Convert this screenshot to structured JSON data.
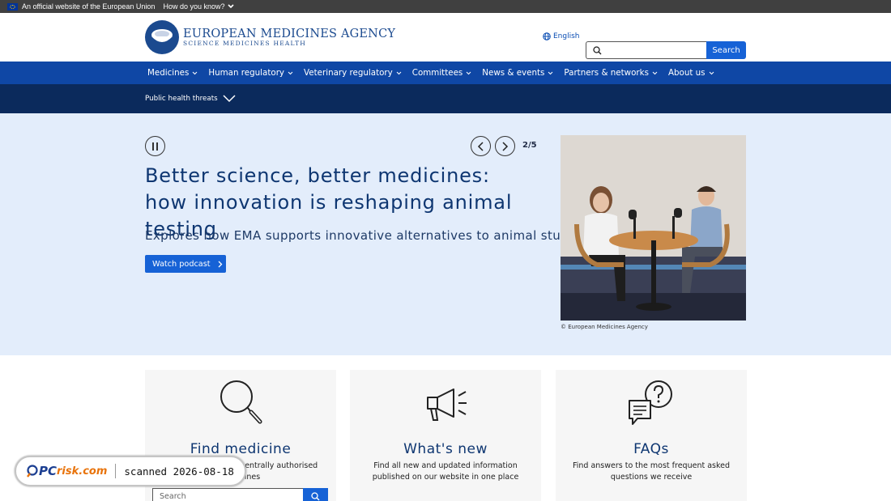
{
  "eu_bar": {
    "official_text": "An official website of the European Union",
    "how_link": "How do you know?"
  },
  "header": {
    "logo_name": "EUROPEAN MEDICINES AGENCY",
    "logo_tagline": "SCIENCE  MEDICINES  HEALTH",
    "language": "English",
    "search_button": "Search"
  },
  "nav": {
    "items": [
      "Medicines",
      "Human regulatory",
      "Veterinary regulatory",
      "Committees",
      "News & events",
      "Partners & networks",
      "About us"
    ]
  },
  "subnav": {
    "label": "Public health threats"
  },
  "hero": {
    "counter": "2/5",
    "title": "Better science, better medicines: how innovation is reshaping animal testing",
    "subtitle": "Explores how EMA supports innovative alternatives to animal studies",
    "cta": "Watch podcast",
    "caption": "© European Medicines Agency"
  },
  "cards": [
    {
      "title": "Find medicine",
      "desc": "Find information on centrally authorised medicines",
      "search_placeholder": "Search"
    },
    {
      "title": "What's new",
      "desc": "Find all new and updated information published on our website in one place"
    },
    {
      "title": "FAQs",
      "desc": "Find answers to the most frequent asked questions we receive"
    }
  ],
  "watermark": {
    "logo_pc": "PC",
    "logo_risk": "risk.com",
    "scan_text": "scanned 2026-08-18"
  },
  "colors": {
    "nav_blue": "#0f47a5",
    "subnav_navy": "#0b2a5c",
    "hero_bg": "#e3edfb",
    "accent": "#1662d6"
  }
}
